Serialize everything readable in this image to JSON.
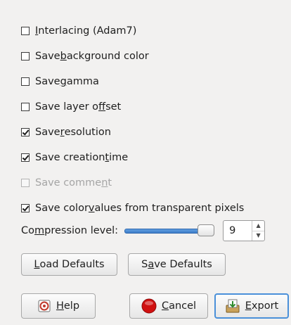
{
  "options": [
    {
      "pre": "",
      "mnemonic": "I",
      "post": "nterlacing (Adam7)",
      "checked": false,
      "enabled": true
    },
    {
      "pre": "Save ",
      "mnemonic": "b",
      "post": "ackground color",
      "checked": false,
      "enabled": true
    },
    {
      "pre": "Save ",
      "mnemonic": "g",
      "post": "amma",
      "checked": false,
      "enabled": true
    },
    {
      "pre": "Save layer o",
      "mnemonic": "ff",
      "post": "set",
      "checked": false,
      "enabled": true
    },
    {
      "pre": "Save ",
      "mnemonic": "r",
      "post": "esolution",
      "checked": true,
      "enabled": true
    },
    {
      "pre": "Save creation ",
      "mnemonic": "t",
      "post": "ime",
      "checked": true,
      "enabled": true
    },
    {
      "pre": "Save comme",
      "mnemonic": "n",
      "post": "t",
      "checked": false,
      "enabled": false
    },
    {
      "pre": "Save color ",
      "mnemonic": "v",
      "post": "alues from transparent pixels",
      "checked": true,
      "enabled": true
    }
  ],
  "compression": {
    "pre": "Co",
    "mnemonic": "m",
    "post": "pression level:",
    "value": "9",
    "level_fraction": 1.0
  },
  "buttons": {
    "load_defaults": {
      "mnemonic": "L",
      "post": "oad Defaults"
    },
    "save_defaults": {
      "pre": "S",
      "mnemonic": "a",
      "post": "ve Defaults"
    },
    "help": {
      "mnemonic": "H",
      "post": "elp",
      "icon": "help-icon"
    },
    "cancel": {
      "mnemonic": "C",
      "post": "ancel",
      "icon": "cancel-icon"
    },
    "export": {
      "mnemonic": "E",
      "post": "xport",
      "icon": "export-icon"
    }
  },
  "colors": {
    "accent": "#4a90d9",
    "slider_fill": "#3e7dc8",
    "cancel_icon": "#d01010"
  }
}
